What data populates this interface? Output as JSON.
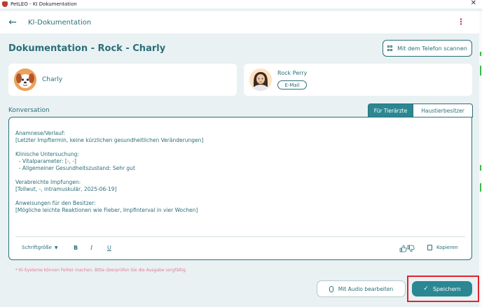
{
  "window": {
    "title": "PetLEO - KI Dokumentation",
    "close": "✕"
  },
  "appbar": {
    "title": "KI-Dokumentation",
    "back_icon": "arrow-left-icon",
    "menu_icon": "more-vertical-icon"
  },
  "page": {
    "title": "Dokumentation - Rock - Charly",
    "scan_button": "Mit dem Telefon scannen"
  },
  "patient": {
    "name": "Charly"
  },
  "owner": {
    "name": "Rock Perry",
    "email_button": "E-Mail"
  },
  "conversation": {
    "label": "Konversation",
    "tabs": [
      "Für Tierärzte",
      "Haustierbesitzer"
    ],
    "active_tab": "Für Tierärzte",
    "content": "Anamnese/Verlauf:\n[Letzter Impftermin, keine kürzlichen gesundheitlichen Veränderungen]\n\nKlinische Untersuchung:\n  - Vitalparameter: [-, -]\n  - Allgemeiner Gesundheitszustand: Sehr gut\n\nVerabreichte Impfungen:\n[Tollwut, -, intramuskulär, 2025-06-19]\n\nAnweisungen für den Besitzer:\n[Mögliche leichte Reaktionen wie Fieber, Impfinterval in vier Wochen]"
  },
  "toolbar": {
    "font_size": "Schriftgröße",
    "bold": "B",
    "italic": "I",
    "underline": "U",
    "copy": "Kopieren"
  },
  "disclaimer": "* KI-Systeme können Fehler machen. Bitte überprüfen Sie die Ausgabe sorgfältig.",
  "actions": {
    "audio": "Mit Audio bearbeiten",
    "save": "Speichern"
  },
  "colors": {
    "primary": "#2b8792",
    "text": "#2b6f78",
    "background": "#e9f1f3",
    "highlight": "#e0242d"
  }
}
